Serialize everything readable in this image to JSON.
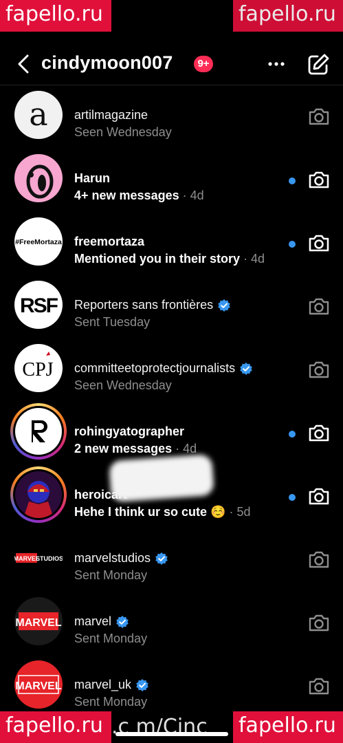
{
  "header": {
    "username": "cindymoon007",
    "badge": "9+"
  },
  "threads": [
    {
      "name": "artilmagazine",
      "subtitle": "Seen Wednesday",
      "unread": false,
      "verified": false,
      "avatar_icon": "letter-a-logo"
    },
    {
      "name": "Harun",
      "subtitle_bold": "4+ new messages",
      "time": " · 4d",
      "unread": true,
      "verified": false,
      "avatar_icon": "pink-cartoon"
    },
    {
      "name": "freemortaza",
      "subtitle_bold": "Mentioned you in their story",
      "time": " · 4d",
      "unread": true,
      "verified": false,
      "avatar_icon": "free-mortaza-text",
      "avatar_text": "#FreeMortaza"
    },
    {
      "name": "Reporters sans frontières",
      "subtitle": "Sent Tuesday",
      "unread": false,
      "verified": true,
      "avatar_icon": "rsf-logo",
      "avatar_text": "RSF"
    },
    {
      "name": "committeetoprotectjournalists",
      "subtitle": "Seen Wednesday",
      "unread": false,
      "verified": true,
      "avatar_icon": "cpj-logo",
      "avatar_text": "CPJ"
    },
    {
      "name": "rohingyatographer",
      "subtitle_bold": "2 new messages",
      "time": " · 4d",
      "unread": true,
      "verified": false,
      "avatar_icon": "r-logo",
      "story_ring": true
    },
    {
      "name": "heroicart",
      "subtitle_bold": "Hehe I think ur so cute ☺️",
      "time": " · 5d",
      "unread": true,
      "verified": false,
      "avatar_icon": "superhero-art",
      "story_ring": true
    },
    {
      "name": "marvelstudios",
      "subtitle": "Sent Monday",
      "unread": false,
      "verified": true,
      "avatar_icon": "marvel-studios-logo",
      "avatar_text": "MARVEL STUDIOS"
    },
    {
      "name": "marvel",
      "subtitle": "Sent Monday",
      "unread": false,
      "verified": true,
      "avatar_icon": "marvel-logo",
      "avatar_text": "MARVEL"
    },
    {
      "name": "marvel_uk",
      "subtitle": "Sent Monday",
      "unread": false,
      "verified": true,
      "avatar_icon": "marvel-logo",
      "avatar_text": "MARVEL"
    }
  ],
  "watermark": {
    "text": "fapello.ru",
    "bottom_url": ".c m/Cinc"
  },
  "colors": {
    "background": "#000000",
    "unread_dot": "#3897f0",
    "badge": "#ff2d55",
    "verified": "#3897f0",
    "watermark": "#e0103a"
  }
}
